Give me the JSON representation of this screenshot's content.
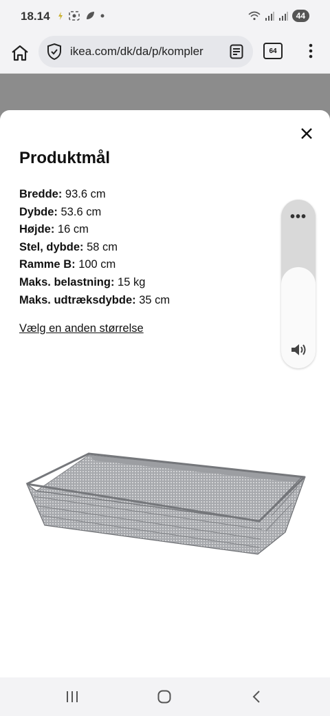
{
  "status_bar": {
    "time": "18.14",
    "battery": "44",
    "left_icons": [
      "charging-icon",
      "screenshot-icon",
      "leaf-icon",
      "dot-icon"
    ],
    "right_icons": [
      "wifi-icon",
      "signal-icon",
      "signal-icon",
      "battery-icon"
    ]
  },
  "browser": {
    "url": "ikea.com/dk/da/p/kompler",
    "tab_count": "64"
  },
  "modal": {
    "title": "Produktmål",
    "dimensions": [
      {
        "label": "Bredde:",
        "value": " 93.6 cm"
      },
      {
        "label": "Dybde:",
        "value": " 53.6 cm"
      },
      {
        "label": "Højde:",
        "value": " 16 cm"
      },
      {
        "label": "Stel, dybde:",
        "value": " 58 cm"
      },
      {
        "label": "Ramme B:",
        "value": " 100 cm"
      },
      {
        "label": "Maks. belastning:",
        "value": " 15 kg"
      },
      {
        "label": "Maks. udtræksdybde:",
        "value": " 35 cm"
      }
    ],
    "size_link": "Vælg en anden størrelse"
  },
  "volume": {
    "menu": "•••",
    "level": 0.6
  },
  "colors": {
    "dim_overlay": "#8c8c8c",
    "chrome": "#f3f3f5",
    "basket": "#8e9094"
  }
}
